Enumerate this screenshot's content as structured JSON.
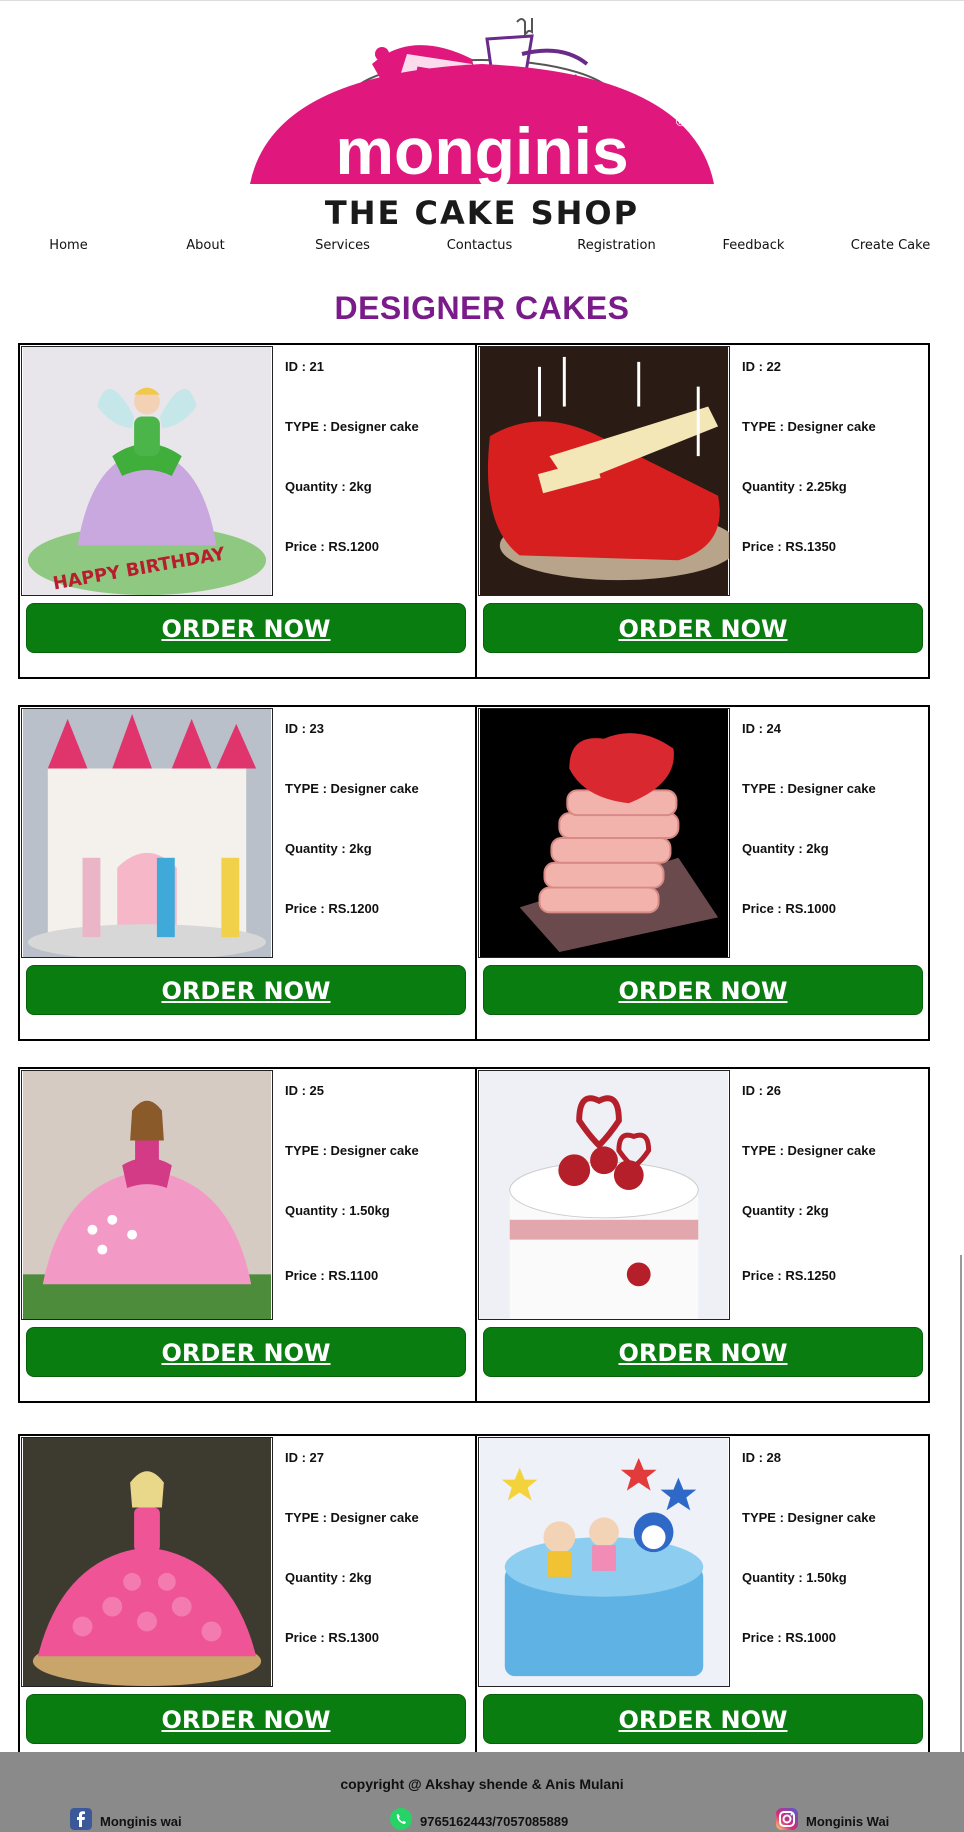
{
  "brand": {
    "name": "monginis",
    "registered": "®",
    "tagline": "THE CAKE SHOP",
    "colors": {
      "pink": "#e0187d",
      "purple": "#6a2a8a",
      "dark": "#1a1a1a"
    }
  },
  "nav": {
    "items": [
      {
        "label": "Home"
      },
      {
        "label": "About"
      },
      {
        "label": "Services"
      },
      {
        "label": "Contactus"
      },
      {
        "label": "Registration"
      },
      {
        "label": "Feedback"
      },
      {
        "label": "Create Cake"
      }
    ]
  },
  "page": {
    "title": "DESIGNER CAKES",
    "title_color": "#7a1b8a"
  },
  "cakes": [
    {
      "id": "ID : 21",
      "type": "TYPE : Designer cake",
      "quantity": "Quantity : 2kg",
      "price": "Price : RS.1200",
      "order_label": "ORDER NOW",
      "image": "fairy-doll-cake-image"
    },
    {
      "id": "ID : 22",
      "type": "TYPE : Designer cake",
      "quantity": "Quantity : 2.25kg",
      "price": "Price : RS.1350",
      "order_label": "ORDER NOW",
      "image": "guitar-cake-image"
    },
    {
      "id": "ID : 23",
      "type": "TYPE : Designer cake",
      "quantity": "Quantity : 2kg",
      "price": "Price : RS.1200",
      "order_label": "ORDER NOW",
      "image": "princess-castle-cake-image"
    },
    {
      "id": "ID : 24",
      "type": "TYPE : Designer cake",
      "quantity": "Quantity : 2kg",
      "price": "Price : RS.1000",
      "order_label": "ORDER NOW",
      "image": "heart-stack-cake-image"
    },
    {
      "id": "ID : 25",
      "type": "TYPE : Designer cake",
      "quantity": "Quantity : 1.50kg",
      "price": "Price : RS.1100",
      "order_label": "ORDER NOW",
      "image": "pink-doll-cake-image"
    },
    {
      "id": "ID : 26",
      "type": "TYPE : Designer cake",
      "quantity": "Quantity : 2kg",
      "price": "Price : RS.1250",
      "order_label": "ORDER NOW",
      "image": "red-heart-rose-cake-image"
    },
    {
      "id": "ID : 27",
      "type": "TYPE : Designer cake",
      "quantity": "Quantity : 2kg",
      "price": "Price : RS.1300",
      "order_label": "ORDER NOW",
      "image": "barbie-rosette-cake-image"
    },
    {
      "id": "ID : 28",
      "type": "TYPE : Designer cake",
      "quantity": "Quantity : 1.50kg",
      "price": "Price : RS.1000",
      "order_label": "ORDER NOW",
      "image": "cartoon-stars-cake-image"
    }
  ],
  "order_button_color": "#0a7d10",
  "footer": {
    "copyright": "copyright @ Akshay shende & Anis Mulani",
    "facebook": {
      "label": "Monginis wai",
      "icon": "facebook-icon"
    },
    "whatsapp": {
      "label": "9765162443/7057085889",
      "icon": "whatsapp-icon"
    },
    "instagram": {
      "label": "Monginis Wai",
      "icon": "instagram-icon"
    }
  }
}
